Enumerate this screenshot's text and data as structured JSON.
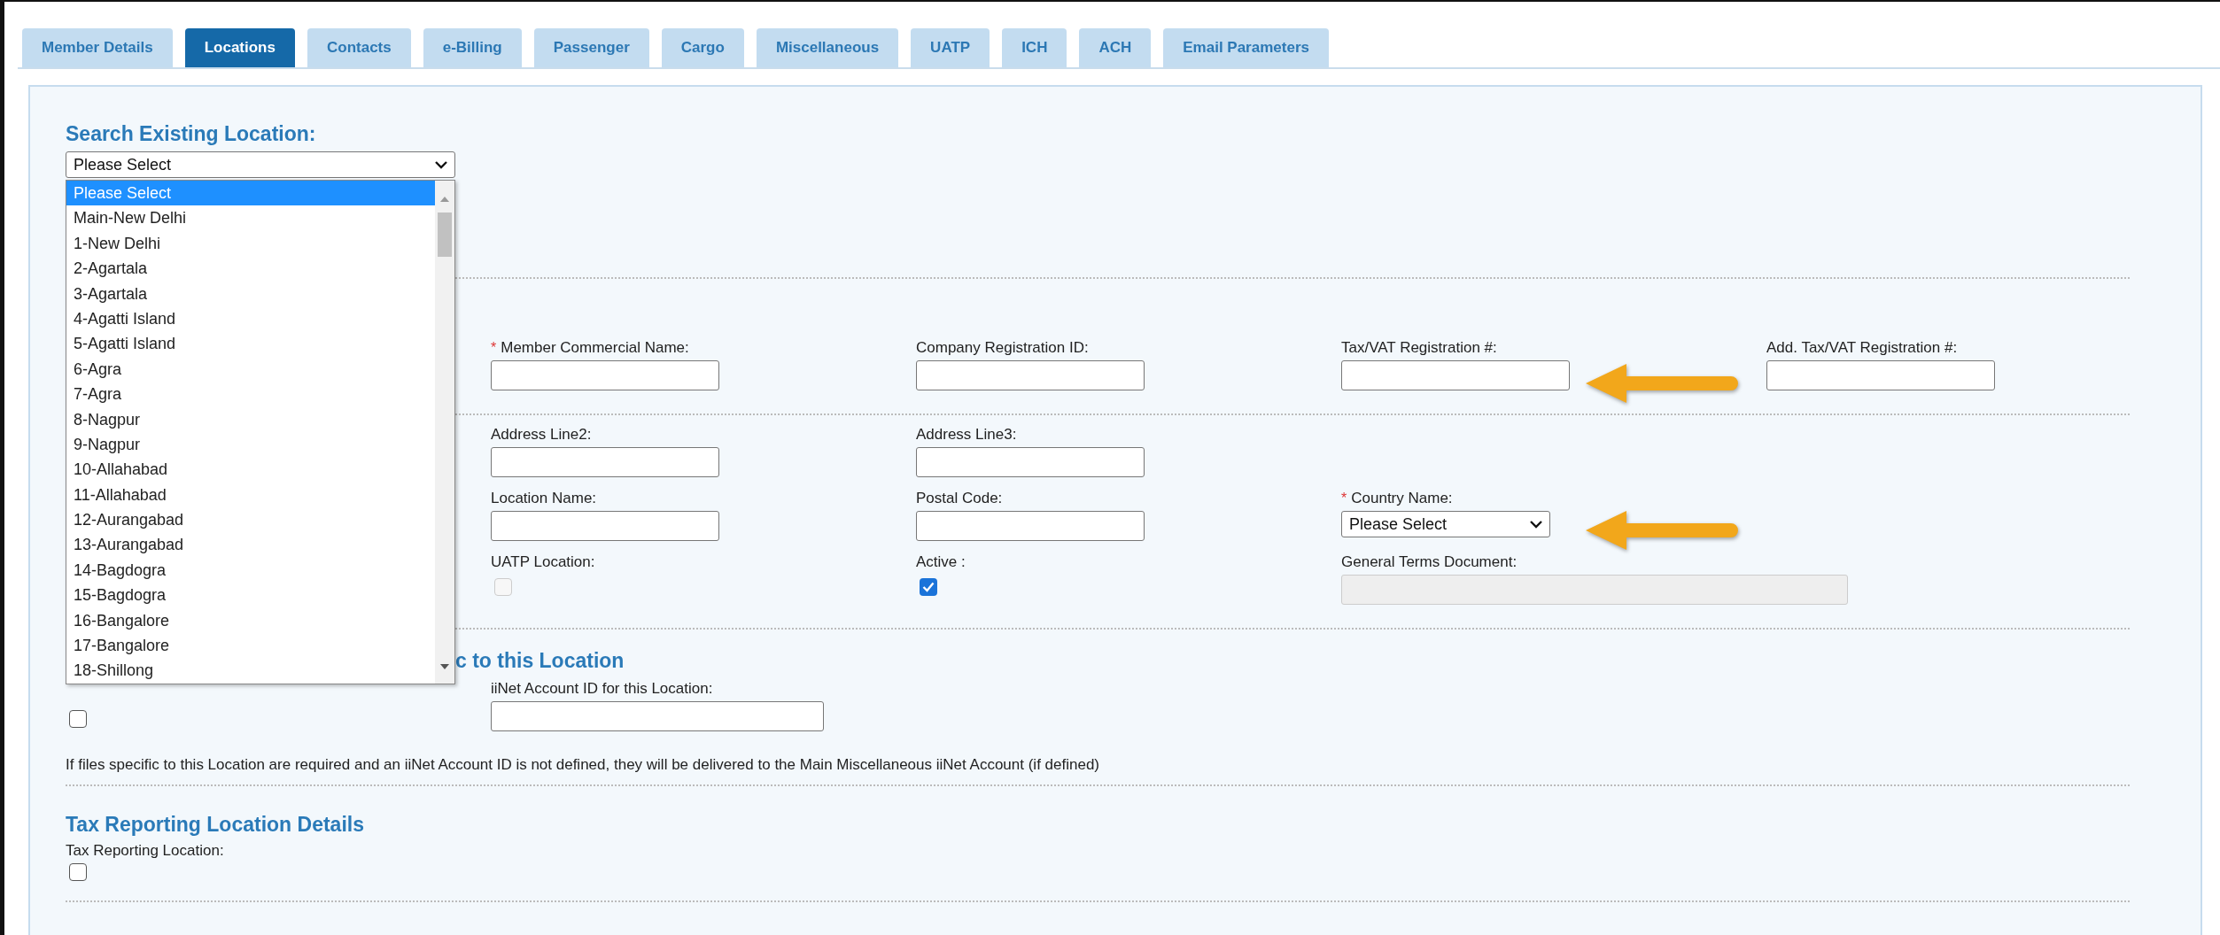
{
  "tabs": [
    {
      "label": "Member Details",
      "selected": false
    },
    {
      "label": "Locations",
      "selected": true
    },
    {
      "label": "Contacts",
      "selected": false
    },
    {
      "label": "e-Billing",
      "selected": false
    },
    {
      "label": "Passenger",
      "selected": false
    },
    {
      "label": "Cargo",
      "selected": false
    },
    {
      "label": "Miscellaneous",
      "selected": false
    },
    {
      "label": "UATP",
      "selected": false
    },
    {
      "label": "ICH",
      "selected": false
    },
    {
      "label": "ACH",
      "selected": false
    },
    {
      "label": "Email Parameters",
      "selected": false
    }
  ],
  "search": {
    "heading": "Search Existing Location:",
    "value": "Please Select",
    "options": [
      {
        "label": "Please Select",
        "selected": true
      },
      {
        "label": "Main-New Delhi",
        "selected": false
      },
      {
        "label": "1-New Delhi",
        "selected": false
      },
      {
        "label": "2-Agartala",
        "selected": false
      },
      {
        "label": "3-Agartala",
        "selected": false
      },
      {
        "label": "4-Agatti Island",
        "selected": false
      },
      {
        "label": "5-Agatti Island",
        "selected": false
      },
      {
        "label": "6-Agra",
        "selected": false
      },
      {
        "label": "7-Agra",
        "selected": false
      },
      {
        "label": "8-Nagpur",
        "selected": false
      },
      {
        "label": "9-Nagpur",
        "selected": false
      },
      {
        "label": "10-Allahabad",
        "selected": false
      },
      {
        "label": "11-Allahabad",
        "selected": false
      },
      {
        "label": "12-Aurangabad",
        "selected": false
      },
      {
        "label": "13-Aurangabad",
        "selected": false
      },
      {
        "label": "14-Bagdogra",
        "selected": false
      },
      {
        "label": "15-Bagdogra",
        "selected": false
      },
      {
        "label": "16-Bangalore",
        "selected": false
      },
      {
        "label": "17-Bangalore",
        "selected": false
      },
      {
        "label": "18-Shillong",
        "selected": false
      }
    ]
  },
  "details": {
    "rows": [
      [
        {
          "kind": "text",
          "required_mark": "*",
          "label": "Member Commercial Name:"
        },
        {
          "kind": "text",
          "label": "Company Registration ID:"
        },
        {
          "kind": "text",
          "label": "Tax/VAT Registration #:",
          "callout_arrow": true
        },
        {
          "kind": "text",
          "label": "Add. Tax/VAT Registration #:"
        }
      ],
      [
        {
          "kind": "text",
          "label": "Address Line2:"
        },
        {
          "kind": "text",
          "label": "Address Line3:"
        }
      ],
      [
        {
          "kind": "text",
          "label": "Location Name:"
        },
        {
          "kind": "text",
          "label": "Postal Code:"
        },
        {
          "kind": "select",
          "required_mark": "*",
          "label": "Country Name:",
          "value": "Please Select",
          "callout_arrow": true
        }
      ],
      [
        {
          "kind": "checkbox",
          "label": "UATP Location:",
          "checked": false,
          "disabled": true
        },
        {
          "kind": "checkbox",
          "label": "Active :",
          "checked": true,
          "disabled": false
        },
        {
          "kind": "readonly",
          "label": "General Terms Document:"
        }
      ]
    ]
  },
  "files": {
    "heading": "c to this Location",
    "checkbox": {
      "checked": false
    },
    "iinet_label": "iiNet Account ID for this Location:",
    "note": "If files specific to this Location are required and an iiNet Account ID is not defined, they will be delivered to the Main Miscellaneous iiNet Account (if defined)"
  },
  "tax": {
    "heading": "Tax Reporting Location Details",
    "label": "Tax Reporting Location:",
    "checkbox": {
      "checked": false
    }
  }
}
